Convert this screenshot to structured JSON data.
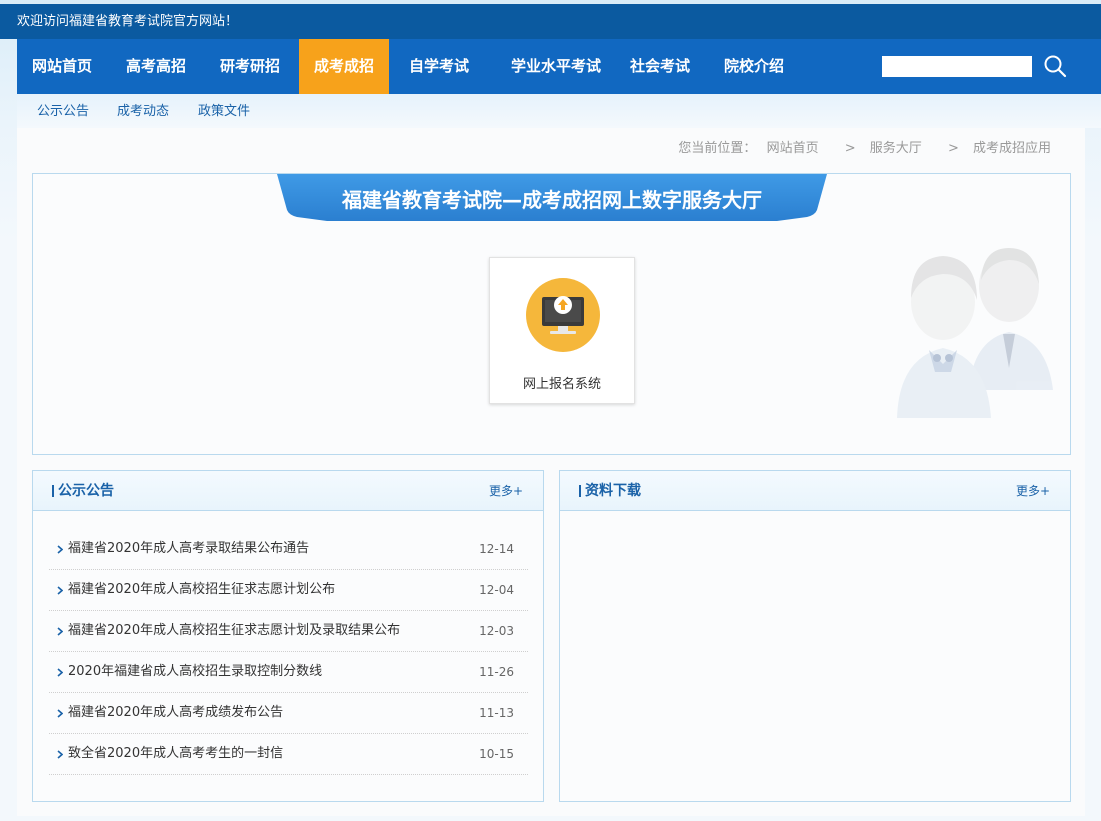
{
  "topbar": {
    "welcome": "欢迎访问福建省教育考试院官方网站！"
  },
  "nav": {
    "items": [
      {
        "label": "网站首页"
      },
      {
        "label": "高考高招"
      },
      {
        "label": "研考研招"
      },
      {
        "label": "成考成招",
        "active": true
      },
      {
        "label": "自学考试"
      },
      {
        "label": "学业水平考试"
      },
      {
        "label": "社会考试"
      },
      {
        "label": "院校介绍"
      }
    ],
    "search": {
      "value": "",
      "icon": "search-icon"
    },
    "active_color": "#f7a21b",
    "bar_color": "#1168c1"
  },
  "subnav": {
    "items": [
      {
        "label": "公示公告"
      },
      {
        "label": "成考动态"
      },
      {
        "label": "政策文件"
      }
    ]
  },
  "breadcrumb": {
    "prefix": "您当前位置：",
    "items": [
      "网站首页",
      "服务大厅",
      "成考成招应用"
    ],
    "separator": ">"
  },
  "hall": {
    "title": "福建省教育考试院—成考成招网上数字服务大厅",
    "services": [
      {
        "label": "网上报名系统",
        "icon": "monitor-upload-icon"
      }
    ]
  },
  "notices": {
    "title": "公示公告",
    "more": "更多+",
    "items": [
      {
        "title": "福建省2020年成人高考录取结果公布通告",
        "date": "12-14"
      },
      {
        "title": "福建省2020年成人高校招生征求志愿计划公布",
        "date": "12-04"
      },
      {
        "title": "福建省2020年成人高校招生征求志愿计划及录取结果公布",
        "date": "12-03"
      },
      {
        "title": "2020年福建省成人高校招生录取控制分数线",
        "date": "11-26"
      },
      {
        "title": "福建省2020年成人高考成绩发布公告",
        "date": "11-13"
      },
      {
        "title": "致全省2020年成人高考考生的一封信",
        "date": "10-15"
      }
    ]
  },
  "downloads": {
    "title": "资料下载",
    "more": "更多+"
  }
}
